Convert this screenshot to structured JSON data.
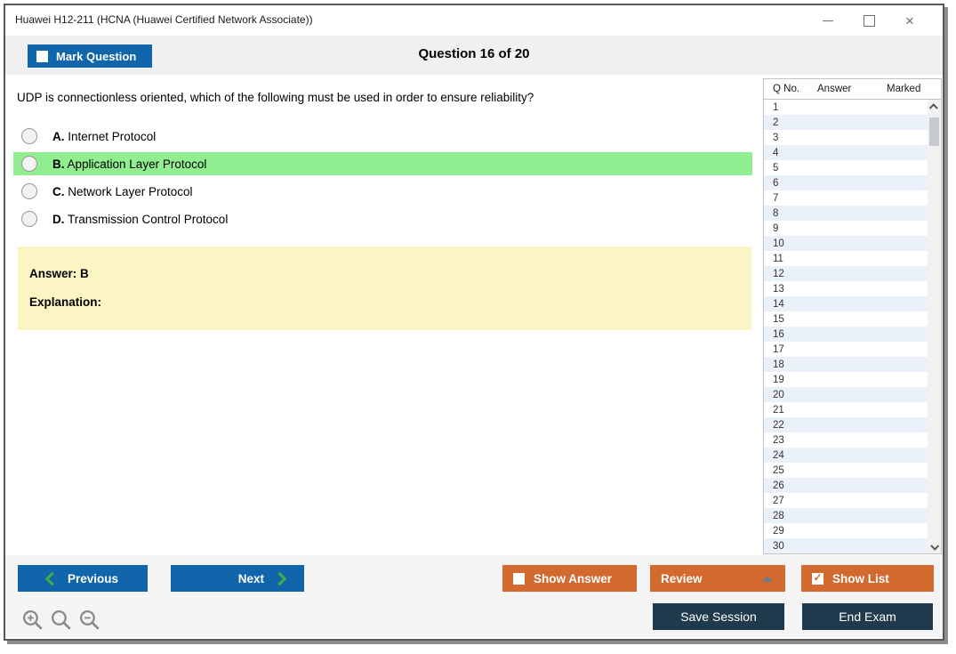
{
  "window": {
    "title": "Huawei H12-211 (HCNA (Huawei Certified Network Associate))"
  },
  "header": {
    "mark_question_label": "Mark Question",
    "question_counter": "Question 16 of 20"
  },
  "question": {
    "text": "UDP is connectionless oriented, which of the following must be used in order to ensure reliability?",
    "options": [
      {
        "letter": "A.",
        "text": "Internet Protocol",
        "highlighted": false
      },
      {
        "letter": "B.",
        "text": "Application Layer Protocol",
        "highlighted": true
      },
      {
        "letter": "C.",
        "text": "Network Layer Protocol",
        "highlighted": false
      },
      {
        "letter": "D.",
        "text": "Transmission Control Protocol",
        "highlighted": false
      }
    ],
    "answer_label": "Answer: B",
    "explanation_label": "Explanation:"
  },
  "sidebar": {
    "columns": {
      "q_no": "Q No.",
      "answer": "Answer",
      "marked": "Marked"
    },
    "rows": [
      {
        "q": "1",
        "answer": "",
        "marked": ""
      },
      {
        "q": "2",
        "answer": "",
        "marked": ""
      },
      {
        "q": "3",
        "answer": "",
        "marked": ""
      },
      {
        "q": "4",
        "answer": "",
        "marked": ""
      },
      {
        "q": "5",
        "answer": "",
        "marked": ""
      },
      {
        "q": "6",
        "answer": "",
        "marked": ""
      },
      {
        "q": "7",
        "answer": "",
        "marked": ""
      },
      {
        "q": "8",
        "answer": "",
        "marked": ""
      },
      {
        "q": "9",
        "answer": "",
        "marked": ""
      },
      {
        "q": "10",
        "answer": "",
        "marked": ""
      },
      {
        "q": "11",
        "answer": "",
        "marked": ""
      },
      {
        "q": "12",
        "answer": "",
        "marked": ""
      },
      {
        "q": "13",
        "answer": "",
        "marked": ""
      },
      {
        "q": "14",
        "answer": "",
        "marked": ""
      },
      {
        "q": "15",
        "answer": "",
        "marked": ""
      },
      {
        "q": "16",
        "answer": "",
        "marked": ""
      },
      {
        "q": "17",
        "answer": "",
        "marked": ""
      },
      {
        "q": "18",
        "answer": "",
        "marked": ""
      },
      {
        "q": "19",
        "answer": "",
        "marked": ""
      },
      {
        "q": "20",
        "answer": "",
        "marked": ""
      },
      {
        "q": "21",
        "answer": "",
        "marked": ""
      },
      {
        "q": "22",
        "answer": "",
        "marked": ""
      },
      {
        "q": "23",
        "answer": "",
        "marked": ""
      },
      {
        "q": "24",
        "answer": "",
        "marked": ""
      },
      {
        "q": "25",
        "answer": "",
        "marked": ""
      },
      {
        "q": "26",
        "answer": "",
        "marked": ""
      },
      {
        "q": "27",
        "answer": "",
        "marked": ""
      },
      {
        "q": "28",
        "answer": "",
        "marked": ""
      },
      {
        "q": "29",
        "answer": "",
        "marked": ""
      },
      {
        "q": "30",
        "answer": "",
        "marked": ""
      }
    ]
  },
  "footer": {
    "previous_label": "Previous",
    "next_label": "Next",
    "show_answer_label": "Show Answer",
    "review_label": "Review",
    "show_list_label": "Show List",
    "save_session_label": "Save Session",
    "end_exam_label": "End Exam"
  },
  "colors": {
    "accent_blue": "#1166ab",
    "accent_orange": "#d2692e",
    "accent_navy": "#1f3a4d",
    "highlight_green": "#90ee90",
    "answer_yellow": "#fbf5c3",
    "alt_row_blue": "#eaf1f8",
    "chevron_green": "#3fae49"
  }
}
